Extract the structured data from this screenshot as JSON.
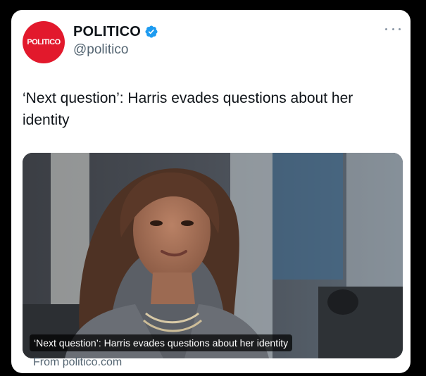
{
  "account": {
    "display_name": "POLITICO",
    "handle": "@politico",
    "avatar_text": "POLITICO",
    "avatar_color": "#e2192c",
    "verified": true
  },
  "tweet": {
    "text": "‘Next question’: Harris evades questions about her identity"
  },
  "link_card": {
    "caption": "‘Next question’: Harris evades questions about her identity",
    "source": "From politico.com"
  },
  "icons": {
    "verified": "verified-badge-icon",
    "more": "more-options-icon"
  },
  "colors": {
    "verified_blue": "#1d9bf0",
    "text_primary": "#0f1419",
    "text_secondary": "#536471"
  }
}
